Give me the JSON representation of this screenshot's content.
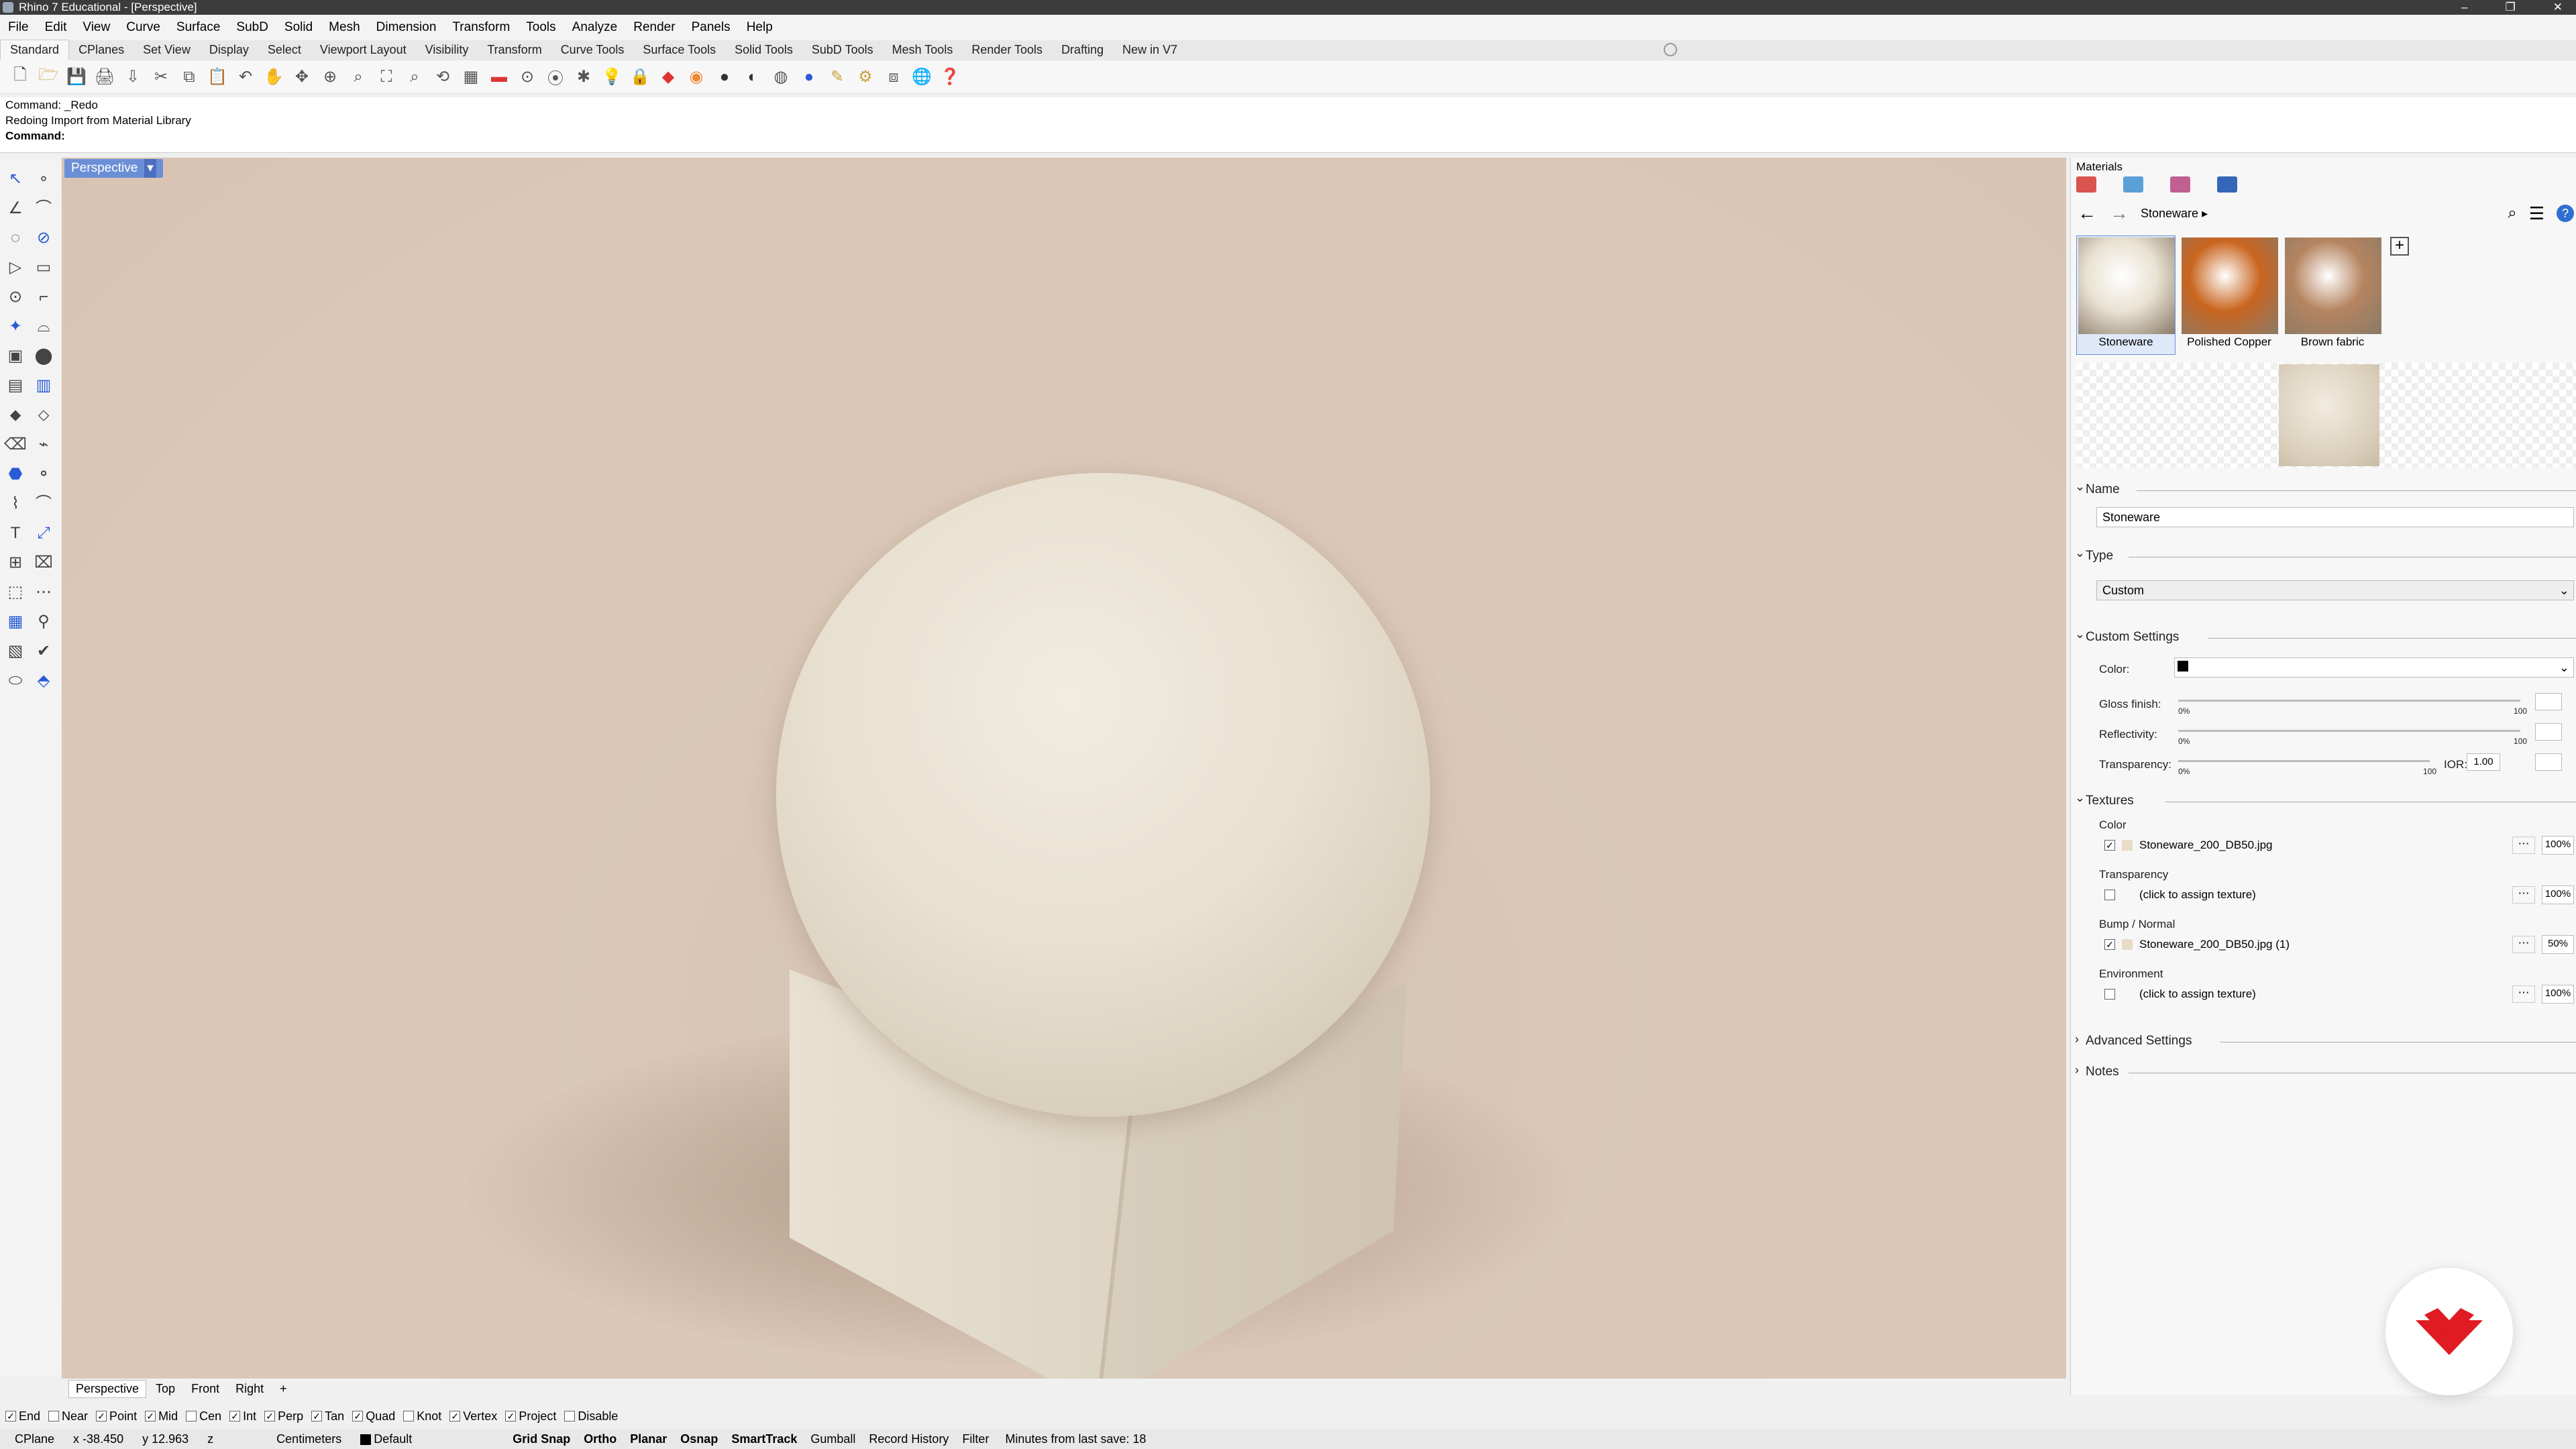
{
  "window": {
    "title": "Rhino 7 Educational - [Perspective]"
  },
  "menu": [
    "File",
    "Edit",
    "View",
    "Curve",
    "Surface",
    "SubD",
    "Solid",
    "Mesh",
    "Dimension",
    "Transform",
    "Tools",
    "Analyze",
    "Render",
    "Panels",
    "Help"
  ],
  "toolbar_tabs": [
    "Standard",
    "CPlanes",
    "Set View",
    "Display",
    "Select",
    "Viewport Layout",
    "Visibility",
    "Transform",
    "Curve Tools",
    "Surface Tools",
    "Solid Tools",
    "SubD Tools",
    "Mesh Tools",
    "Render Tools",
    "Drafting",
    "New in V7"
  ],
  "command": {
    "history": [
      "Command: _Redo",
      "Redoing Import from Material Library"
    ],
    "prompt": "Command:"
  },
  "viewport": {
    "label": "Perspective",
    "tabs": [
      "Perspective",
      "Top",
      "Front",
      "Right"
    ]
  },
  "osnaps": [
    {
      "label": "End",
      "checked": true
    },
    {
      "label": "Near",
      "checked": false
    },
    {
      "label": "Point",
      "checked": true
    },
    {
      "label": "Mid",
      "checked": true
    },
    {
      "label": "Cen",
      "checked": false
    },
    {
      "label": "Int",
      "checked": true
    },
    {
      "label": "Perp",
      "checked": true
    },
    {
      "label": "Tan",
      "checked": true
    },
    {
      "label": "Quad",
      "checked": true
    },
    {
      "label": "Knot",
      "checked": false
    },
    {
      "label": "Vertex",
      "checked": true
    },
    {
      "label": "Project",
      "checked": true
    },
    {
      "label": "Disable",
      "checked": false
    }
  ],
  "status": {
    "cplane": "CPlane",
    "x": "x -38.450",
    "y": "y 12.963",
    "z": "z",
    "units": "Centimeters",
    "layer": "Default",
    "toggles": [
      "Grid Snap",
      "Ortho",
      "Planar",
      "Osnap",
      "SmartTrack",
      "Gumball",
      "Record History",
      "Filter"
    ],
    "bold_toggles": [
      "Grid Snap",
      "Ortho",
      "Planar",
      "Osnap",
      "SmartTrack"
    ],
    "save_info": "Minutes from last save: 18"
  },
  "materials_panel": {
    "title": "Materials",
    "breadcrumb": "Stoneware",
    "thumbnails": [
      {
        "label": "Stoneware",
        "color": "#e9e2d2",
        "selected": true
      },
      {
        "label": "Polished Copper",
        "color": "#c9651f",
        "selected": false
      },
      {
        "label": "Brown fabric",
        "color": "#b58460",
        "selected": false
      }
    ],
    "name_section": "Name",
    "name_value": "Stoneware",
    "type_section": "Type",
    "type_value": "Custom",
    "custom_section": "Custom Settings",
    "color_label": "Color:",
    "gloss_label": "Gloss finish:",
    "reflectivity_label": "Reflectivity:",
    "transparency_label": "Transparency:",
    "ior_label": "IOR:",
    "ior_value": "1.00",
    "slider_min": "0%",
    "slider_max": "100",
    "textures_section": "Textures",
    "textures": [
      {
        "group": "Color",
        "checked": true,
        "file": "Stoneware_200_DB50.jpg",
        "pct": "100%"
      },
      {
        "group": "Transparency",
        "checked": false,
        "file": "(click to assign texture)",
        "pct": "100%"
      },
      {
        "group": "Bump / Normal",
        "checked": true,
        "file": "Stoneware_200_DB50.jpg (1)",
        "pct": "50%"
      },
      {
        "group": "Environment",
        "checked": false,
        "file": "(click to assign texture)",
        "pct": "100%"
      }
    ],
    "advanced_section": "Advanced Settings",
    "notes_section": "Notes"
  }
}
